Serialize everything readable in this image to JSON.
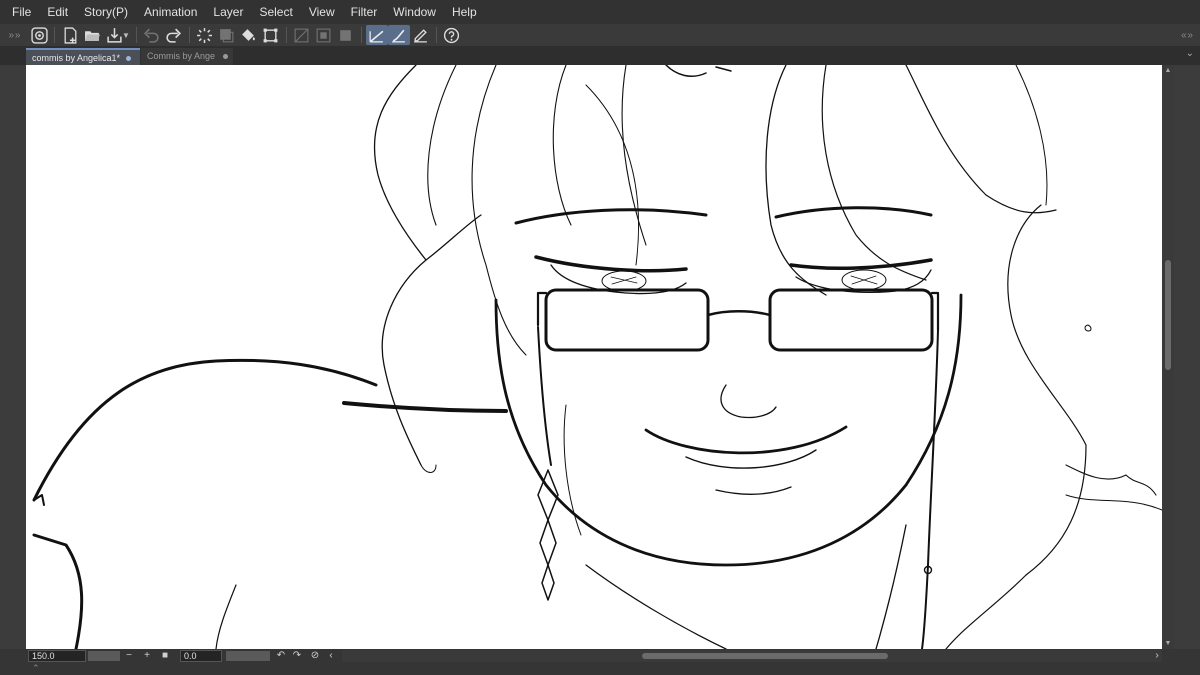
{
  "menubar": {
    "items": [
      "File",
      "Edit",
      "Story(P)",
      "Animation",
      "Layer",
      "Select",
      "View",
      "Filter",
      "Window",
      "Help"
    ]
  },
  "toolbar": {
    "icons": [
      "clip-studio-icon",
      "new-file-icon",
      "open-folder-icon",
      "save-icon",
      "undo-icon",
      "redo-icon",
      "loading-icon",
      "clear-icon",
      "fill-icon",
      "transform-icon",
      "ruler-icon",
      "ruler-alt-icon",
      "square-icon",
      "pen-icon",
      "brush-icon",
      "pencil-icon",
      "help-icon"
    ],
    "active": [
      "pen-icon",
      "brush-icon"
    ]
  },
  "tabs": [
    {
      "label": "commis by Angelica1*",
      "active": true
    },
    {
      "label": "Commis by Ange",
      "active": false
    }
  ],
  "status": {
    "zoom": "150.0",
    "angle": "0.0"
  },
  "colors": {
    "menubar_bg": "#323232",
    "toolbar_bg": "#3a3a3a",
    "active_tab": "#4a4f58",
    "tab_accent": "#6f8fbf",
    "canvas_bg": "#ffffff",
    "line_art": "#111111"
  }
}
